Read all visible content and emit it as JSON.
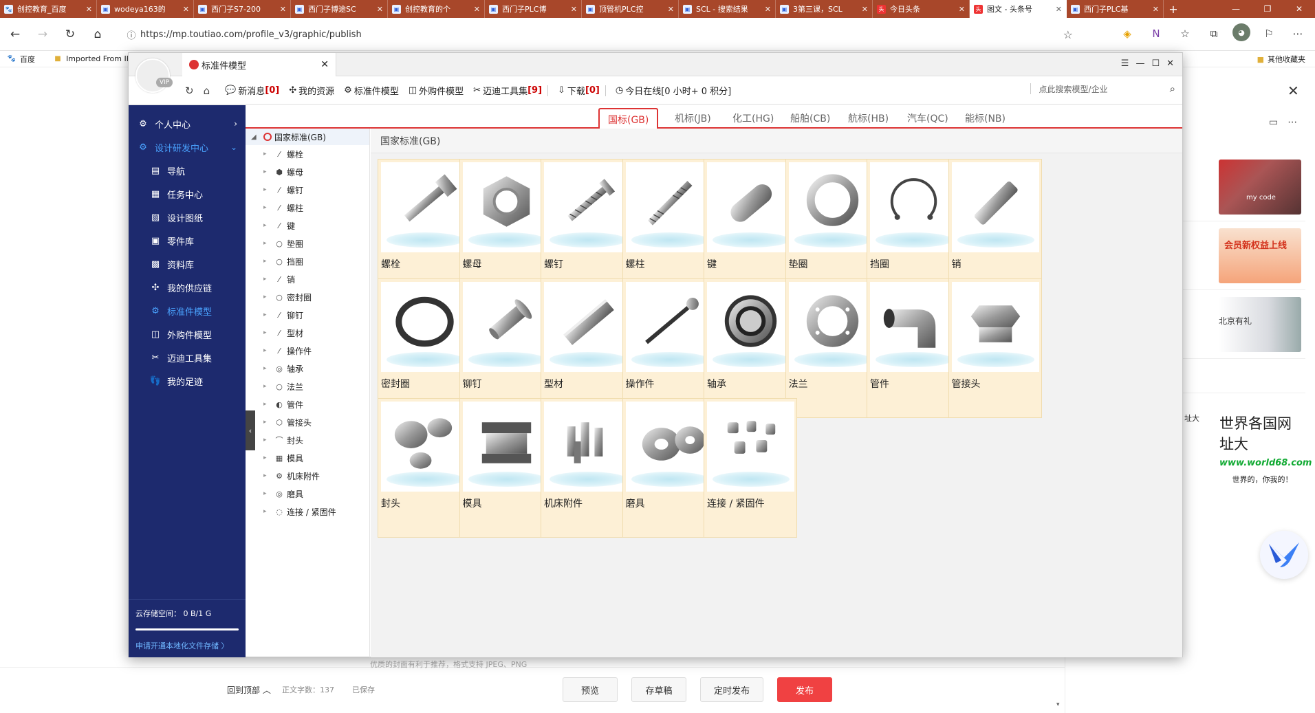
{
  "browser": {
    "tabs": [
      {
        "label": "创控教育_百度",
        "active": false
      },
      {
        "label": "wodeya163的",
        "active": false
      },
      {
        "label": "西门子S7-200",
        "active": false
      },
      {
        "label": "西门子博途SC",
        "active": false
      },
      {
        "label": "创控教育的个",
        "active": false
      },
      {
        "label": "西门子PLC博",
        "active": false
      },
      {
        "label": "顶管机PLC控",
        "active": false
      },
      {
        "label": "SCL - 搜索结果",
        "active": false
      },
      {
        "label": "3第三课，SCL",
        "active": false
      },
      {
        "label": "今日头条",
        "active": false
      },
      {
        "label": "图文 - 头条号",
        "active": true
      },
      {
        "label": "西门子PLC基",
        "active": false
      }
    ],
    "url": "https://mp.toutiao.com/profile_v3/graphic/publish",
    "bookmarks": [
      {
        "label": "百度",
        "icon": "paw-icon"
      },
      {
        "label": "Imported From IE",
        "icon": "folder-icon"
      }
    ],
    "other_bookmarks": "其他收藏夹"
  },
  "background_page": {
    "hint": "优质的封面有利于推荐，格式支持 JPEG、PNG",
    "back_to_top": "回到顶部",
    "word_count": "正文字数：137",
    "saved": "已保存",
    "buttons": {
      "preview": "预览",
      "draft": "存草稿",
      "schedule": "定时发布",
      "publish": "发布"
    },
    "side_cards": [
      {
        "text": "my code"
      },
      {
        "text": "会员新权益上线"
      },
      {
        "text": "北京有礼"
      }
    ],
    "world_title": "世界各国网址大",
    "world_url": "www.world68.com",
    "world_slogan": "世界的，你我的！",
    "side_label": "址大"
  },
  "popup": {
    "window_title": "标准件模型",
    "vip": "VIP",
    "toolbar": {
      "new_messages": "新消息",
      "new_messages_count": "[0]",
      "my_resources": "我的资源",
      "standard_models": "标准件模型",
      "purchased_models": "外购件模型",
      "tools": "迈迪工具集",
      "tools_count": "[9]",
      "download": "下载",
      "download_count": "[0]",
      "online_prefix": "今日在线",
      "online_value": "[0 小时+ 0 积分]",
      "search_placeholder": "点此搜索模型/企业"
    },
    "sidebar": {
      "sections": [
        {
          "label": "个人中心",
          "icon": "gear-icon"
        },
        {
          "label": "设计研发中心",
          "icon": "gear-icon"
        }
      ],
      "items": [
        {
          "label": "导航",
          "icon": "nav-icon"
        },
        {
          "label": "任务中心",
          "icon": "task-icon"
        },
        {
          "label": "设计图纸",
          "icon": "drawing-icon"
        },
        {
          "label": "零件库",
          "icon": "parts-icon"
        },
        {
          "label": "资料库",
          "icon": "docs-icon"
        },
        {
          "label": "我的供应链",
          "icon": "supply-icon"
        },
        {
          "label": "标准件模型",
          "icon": "standard-icon"
        },
        {
          "label": "外购件模型",
          "icon": "purchase-icon"
        },
        {
          "label": "迈迪工具集",
          "icon": "tools-icon"
        },
        {
          "label": "我的足迹",
          "icon": "footprint-icon"
        }
      ],
      "storage_label": "云存储空间：  0 B/1 G",
      "storage_fraction": 1.0,
      "storage_link": "申请开通本地化文件存储 〉"
    },
    "category_tabs": [
      "国标(GB)",
      "机标(JB)",
      "化工(HG)",
      "船舶(CB)",
      "航标(HB)",
      "汽车(QC)",
      "能标(NB)"
    ],
    "tree": {
      "root": "国家标准(GB)",
      "nodes": [
        "螺栓",
        "螺母",
        "螺钉",
        "螺柱",
        "键",
        "垫圈",
        "挡圈",
        "销",
        "密封圈",
        "铆钉",
        "型材",
        "操作件",
        "轴承",
        "法兰",
        "管件",
        "管接头",
        "封头",
        "模具",
        "机床附件",
        "磨具",
        "连接 / 紧固件"
      ]
    },
    "grid_title": "国家标准(GB)",
    "cards": [
      "螺栓",
      "螺母",
      "螺钉",
      "螺柱",
      "键",
      "垫圈",
      "挡圈",
      "销",
      "密封圈",
      "铆钉",
      "型材",
      "操作件",
      "轴承",
      "法兰",
      "管件",
      "管接头",
      "封头",
      "模具",
      "机床附件",
      "磨具",
      "连接 / 紧固件"
    ]
  }
}
